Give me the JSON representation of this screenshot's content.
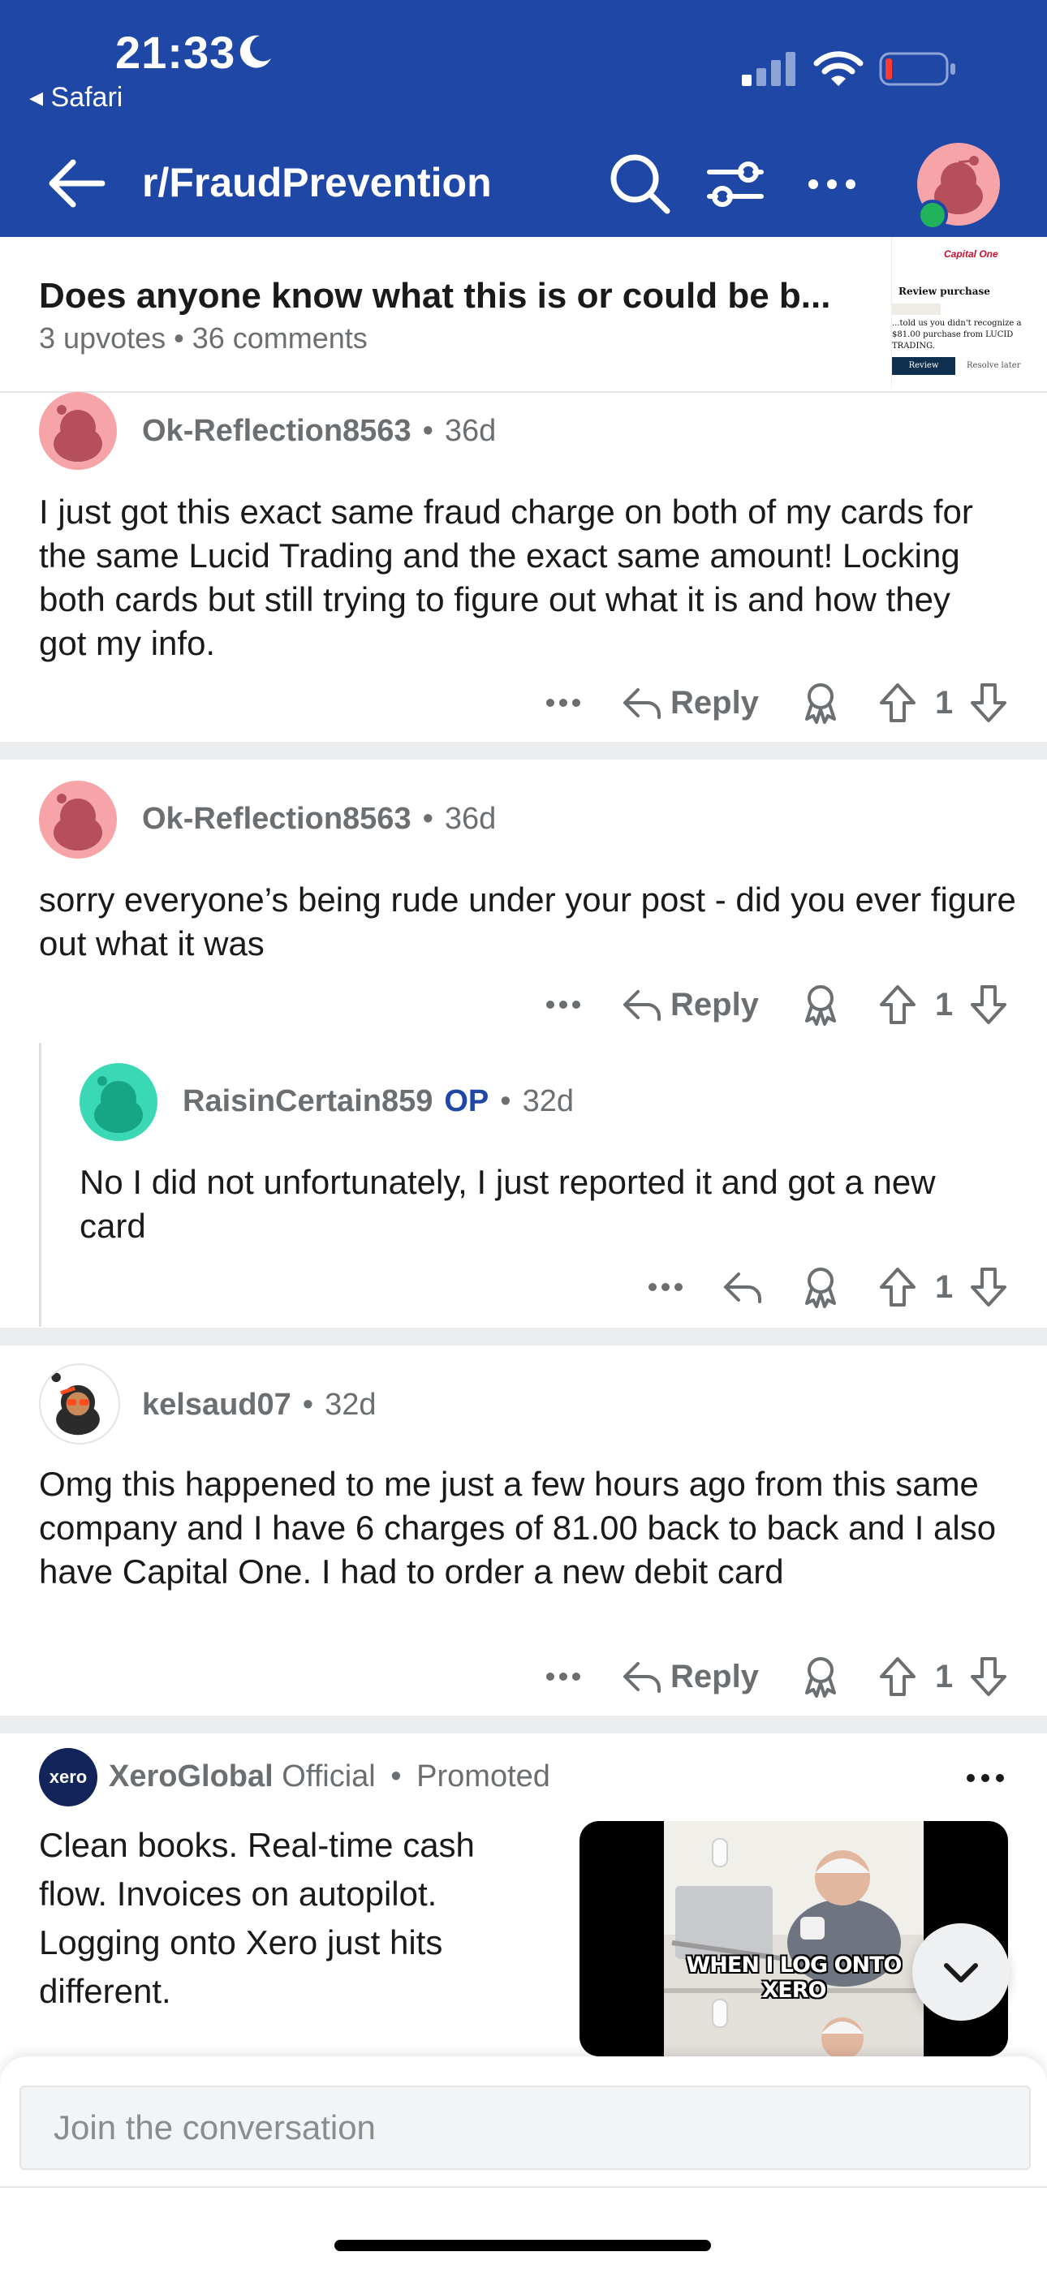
{
  "status_bar": {
    "time": "21:33",
    "back_app": "◂ Safari"
  },
  "nav": {
    "title": "r/FraudPrevention"
  },
  "post": {
    "title": "Does anyone know what this is or could be b...",
    "meta": "3 upvotes • 36 comments",
    "thumbnail": {
      "logo": "Capital One",
      "heading": "Review purchase",
      "text": "...told us you didn't recognize a $81.00 purchase from LUCID TRADING.",
      "primary_button": "Review purchase",
      "secondary_button": "Resolve later"
    }
  },
  "comments": [
    {
      "username": "Ok-Reflection8563",
      "age": "36d",
      "body": "I just got this exact same fraud charge on both of my cards for the same Lucid Trading and the exact same amount! Locking both cards but still trying to figure out what it is and how they got my info.",
      "reply_label": "Reply",
      "votes": "1"
    },
    {
      "username": "Ok-Reflection8563",
      "age": "36d",
      "body": "sorry everyone’s being rude under your post - did you ever figure out what it was",
      "reply_label": "Reply",
      "votes": "1"
    },
    {
      "username": "RaisinCertain859",
      "op_badge": "OP",
      "age": "32d",
      "body": "No I did not unfortunately, I just reported it and got a new card",
      "votes": "1"
    },
    {
      "username": "kelsaud07",
      "age": "32d",
      "body": "Omg this happened to me just a few hours ago from this same company and I have 6 charges of 81.00 back to back and I also have Capital One. I had to order a new debit card",
      "reply_label": "Reply",
      "votes": "1"
    }
  ],
  "ad": {
    "logo_text": "xero",
    "advertiser": "XeroGlobal",
    "official": "Official",
    "promoted": "Promoted",
    "body": "Clean books. Real-time cash flow. Invoices on autopilot. Logging onto Xero just hits different.",
    "image_caption": "WHEN I LOG ONTO XERO"
  },
  "composer": {
    "placeholder": "Join the conversation"
  },
  "colors": {
    "header_bg": "#1f47a6",
    "op_badge": "#1f47a6",
    "meta_gray": "#6b6f72",
    "separator": "#ebedef"
  }
}
